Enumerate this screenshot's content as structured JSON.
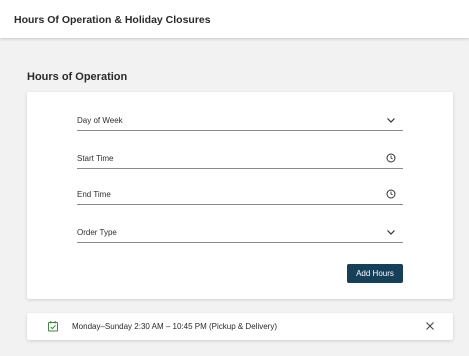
{
  "header": {
    "title": "Hours Of Operation & Holiday Closures"
  },
  "section": {
    "title": "Hours of Operation"
  },
  "form": {
    "day_of_week_label": "Day of Week",
    "start_time_label": "Start Time",
    "end_time_label": "End Time",
    "order_type_label": "Order Type",
    "add_button_label": "Add Hours"
  },
  "hours_entries": [
    {
      "text": "Monday–Sunday 2:30 AM – 10:45 PM (Pickup & Delivery)"
    }
  ],
  "icons": {
    "day_dropdown": "chevron-down-icon",
    "start_time": "clock-icon",
    "end_time": "clock-icon",
    "order_dropdown": "chevron-down-icon",
    "entry_icon": "calendar-check-icon",
    "entry_remove": "close-icon"
  },
  "colors": {
    "primary_button": "#163f5a",
    "calendar_icon": "#3c8a3c",
    "background": "#f2f2f2"
  }
}
